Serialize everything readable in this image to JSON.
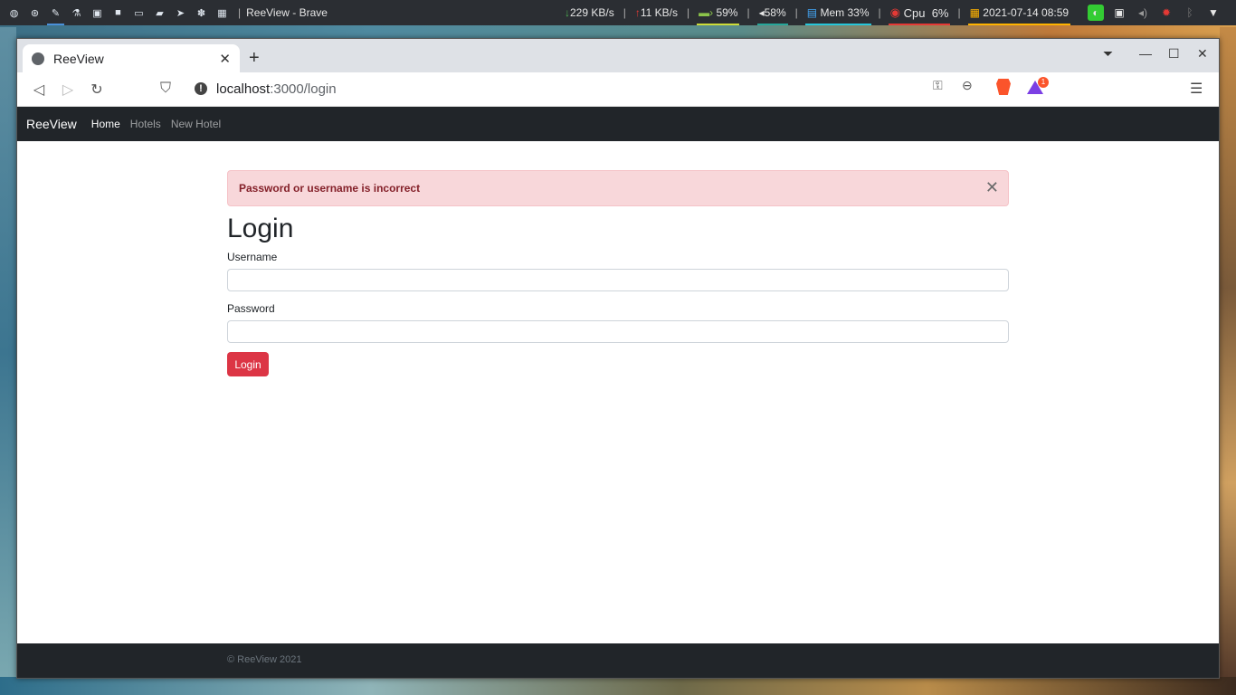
{
  "panel": {
    "window_title": "ReeView - Brave",
    "launchers": [
      "globe-icon",
      "compass-icon",
      "dropper-icon",
      "flask-icon",
      "image-icon",
      "video-icon",
      "laptop-icon",
      "folder-icon",
      "telegram-icon",
      "paw-icon",
      "grid-icon"
    ],
    "net_down": "229 KB/s",
    "net_up": "11 KB/s",
    "battery": "59%",
    "volume": "58%",
    "mem": "Mem 33%",
    "cpu_label": "Cpu",
    "cpu_value": "6%",
    "datetime": "2021-07-14 08:59",
    "sep": "|"
  },
  "browser": {
    "tab_title": "ReeView",
    "url_host": "localhost",
    "url_path": ":3000/login",
    "badge_count": "1"
  },
  "site": {
    "brand": "ReeView",
    "nav": [
      {
        "label": "Home"
      },
      {
        "label": "Hotels"
      },
      {
        "label": "New Hotel"
      }
    ],
    "alert": "Password or username is incorrect",
    "heading": "Login",
    "username_label": "Username",
    "username_value": "",
    "password_label": "Password",
    "password_value": "",
    "login_button": "Login",
    "footer": "© ReeView 2021"
  },
  "colors": {
    "navbar_bg": "#212529",
    "alert_bg": "#f8d7da",
    "alert_text": "#842029",
    "button_bg": "#dc3545"
  }
}
